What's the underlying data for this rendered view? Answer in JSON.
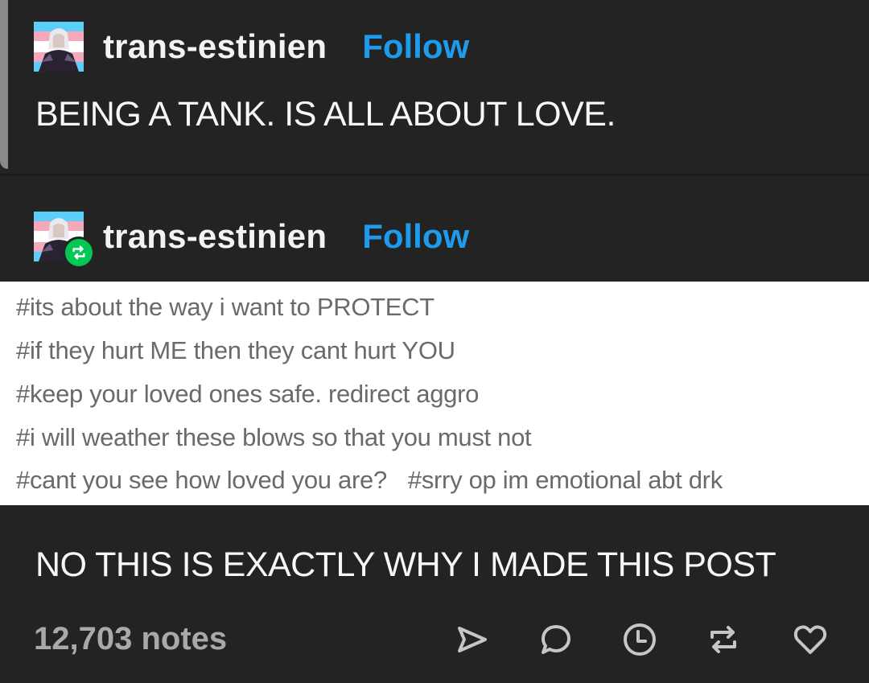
{
  "colors": {
    "background": "#232323",
    "follow_accent": "#1e9bea",
    "reblog_badge": "#00c853",
    "tag_text": "#6a6a6a",
    "tags_background": "#ffffff"
  },
  "original_post": {
    "username": "trans-estinien",
    "follow_label": "Follow",
    "body": "BEING A TANK. IS ALL ABOUT LOVE."
  },
  "reblog": {
    "username": "trans-estinien",
    "follow_label": "Follow",
    "badge_icon": "reblog-icon",
    "tags": [
      [
        "#its about the way i want to PROTECT"
      ],
      [
        "#if they hurt ME then they cant hurt YOU"
      ],
      [
        "#keep your loved ones safe. redirect aggro"
      ],
      [
        "#i will weather these blows so that you must not"
      ],
      [
        "#cant you see how loved you are?",
        "#srry op im emotional abt drk"
      ]
    ],
    "body": "NO THIS IS EXACTLY WHY I MADE THIS POST"
  },
  "footer": {
    "notes": "12,703 notes",
    "actions": [
      "share-icon",
      "reply-icon",
      "queue-icon",
      "reblog-icon",
      "like-icon"
    ]
  }
}
